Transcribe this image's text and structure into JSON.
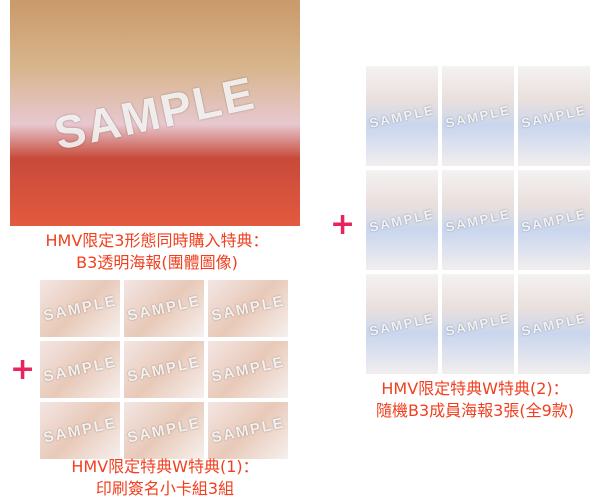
{
  "watermark": "SAMPLE",
  "colors": {
    "caption": "#f0401f",
    "plus": "#e8235d"
  },
  "plus_sign": "+",
  "group_poster": {
    "caption_line1": "HMV限定3形態同時購入特典：",
    "caption_line2": "B3透明海報(團體圖像)"
  },
  "photocards": {
    "count": 9,
    "caption_line1": "HMV限定特典W特典(1)：",
    "caption_line2": "印刷簽名小卡組3組"
  },
  "member_posters": {
    "count": 9,
    "caption_line1": "HMV限定特典W特典(2)：",
    "caption_line2": "隨機B3成員海報3張(全9款)"
  }
}
